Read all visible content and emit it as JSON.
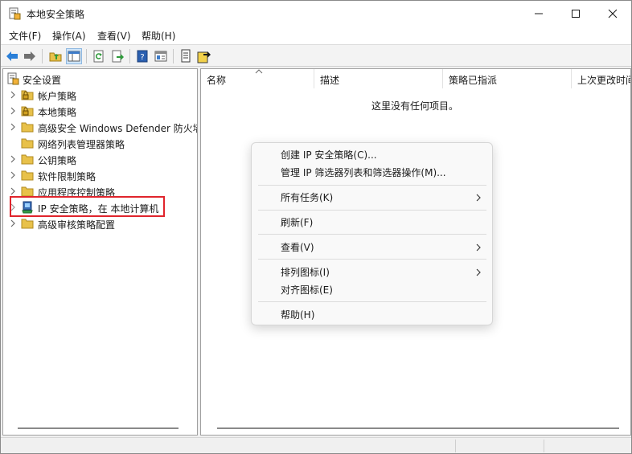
{
  "window": {
    "title": "本地安全策略",
    "icon": "security-policy-icon"
  },
  "menubar": {
    "items": [
      "文件(F)",
      "操作(A)",
      "查看(V)",
      "帮助(H)"
    ]
  },
  "toolbar": {
    "icons": [
      "back-arrow-icon",
      "forward-arrow-icon",
      "up-folder-icon",
      "show-hide-tree-icon",
      "refresh-icon",
      "export-list-icon",
      "help-icon",
      "properties-icon",
      "import-policy-icon",
      "export-policy-icon"
    ],
    "pressed": "show-hide-tree-icon"
  },
  "tree": {
    "root": "安全设置",
    "items": [
      {
        "label": "帐户策略",
        "icon": "folder-lock-icon"
      },
      {
        "label": "本地策略",
        "icon": "folder-lock-icon"
      },
      {
        "label": "高级安全 Windows Defender 防火墙",
        "icon": "folder-icon"
      },
      {
        "label": "网络列表管理器策略",
        "icon": "folder-icon"
      },
      {
        "label": "公钥策略",
        "icon": "folder-icon"
      },
      {
        "label": "软件限制策略",
        "icon": "folder-icon"
      },
      {
        "label": "应用程序控制策略",
        "icon": "folder-icon"
      },
      {
        "label": "IP 安全策略，在 本地计算机",
        "icon": "ip-security-icon"
      },
      {
        "label": "高级审核策略配置",
        "icon": "folder-icon"
      }
    ],
    "highlighted_index": 7
  },
  "list": {
    "columns": [
      "名称",
      "描述",
      "策略已指派",
      "上次更改时间"
    ],
    "empty_message": "这里没有任何项目。"
  },
  "context_menu": {
    "items": [
      {
        "label": "创建 IP 安全策略(C)...",
        "submenu": false
      },
      {
        "label": "管理 IP 筛选器列表和筛选器操作(M)...",
        "submenu": false
      },
      {
        "label": "所有任务(K)",
        "submenu": true
      },
      {
        "label": "刷新(F)",
        "submenu": false
      },
      {
        "label": "查看(V)",
        "submenu": true
      },
      {
        "label": "排列图标(I)",
        "submenu": true
      },
      {
        "label": "对齐图标(E)",
        "submenu": false
      },
      {
        "label": "帮助(H)",
        "submenu": false
      }
    ]
  },
  "colors": {
    "accent_blue": "#1e6fd0",
    "highlight_red": "#e0242c",
    "folder_yellow": "#e8c14a"
  }
}
